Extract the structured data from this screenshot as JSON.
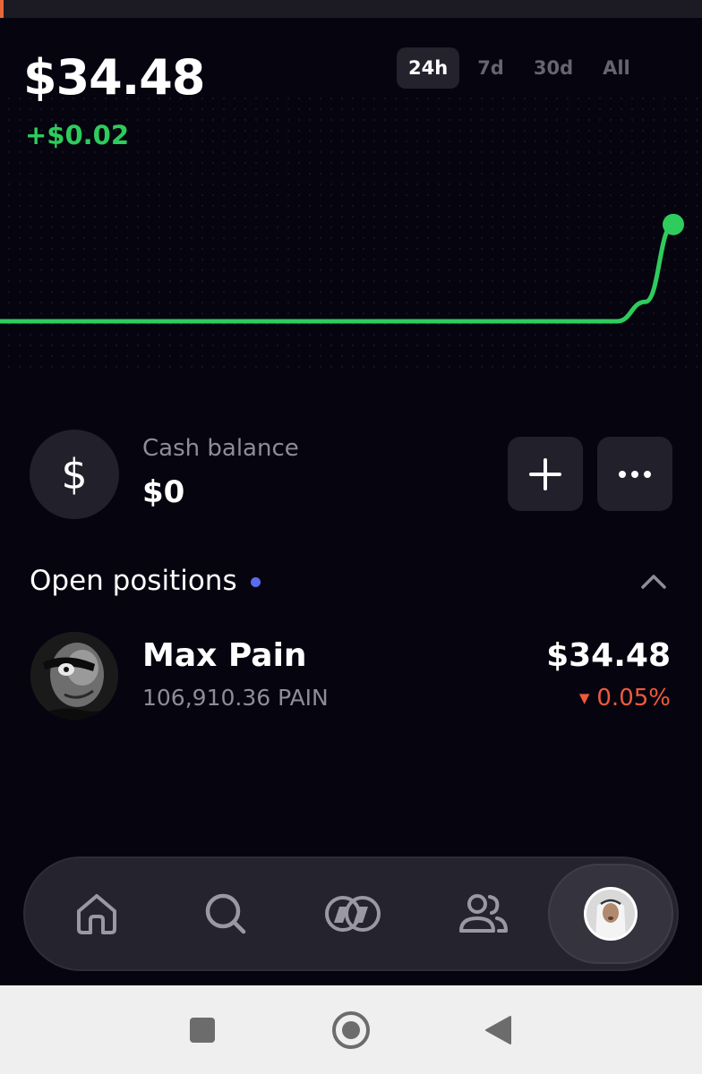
{
  "portfolio": {
    "balance_main": "$34",
    "balance_cents": ".48",
    "change": "+$0.02"
  },
  "range_tabs": [
    {
      "label": "24h",
      "active": true
    },
    {
      "label": "7d",
      "active": false
    },
    {
      "label": "30d",
      "active": false
    },
    {
      "label": "All",
      "active": false
    }
  ],
  "chart_data": {
    "type": "line",
    "title": "",
    "xlabel": "",
    "ylabel": "",
    "grid": false,
    "series": [
      {
        "values": [
          34.46,
          34.46,
          34.46,
          34.46,
          34.46,
          34.46,
          34.46,
          34.46,
          34.46,
          34.46,
          34.46,
          34.46,
          34.46,
          34.46,
          34.46,
          34.46,
          34.46,
          34.46,
          34.46,
          34.46,
          34.46,
          34.46,
          34.46,
          34.464,
          34.48
        ]
      }
    ],
    "ylim": [
      34.455,
      34.482
    ],
    "line_color": "#2ecc5c"
  },
  "cash": {
    "icon": "dollar-sign-icon",
    "symbol": "$",
    "label": "Cash balance",
    "value": "$0",
    "add_icon": "plus-icon",
    "more_icon": "more-horizontal-icon"
  },
  "open_positions": {
    "title": "Open positions",
    "indicator_color": "#5a6bf0",
    "collapse_icon": "chevron-up-icon",
    "items": [
      {
        "name": "Max Pain",
        "amount": "106,910.36 PAIN",
        "value": "$34.48",
        "change_arrow": "▼",
        "change": "0.05%",
        "change_color": "#ef5a3c"
      }
    ]
  },
  "nav": {
    "items": [
      {
        "icon": "home-icon"
      },
      {
        "icon": "search-icon"
      },
      {
        "icon": "trade-coins-icon"
      },
      {
        "icon": "users-icon"
      },
      {
        "icon": "profile-avatar-icon",
        "active": true
      }
    ]
  },
  "system_nav": {
    "recents_icon": "square-icon",
    "home_icon": "circle-home-icon",
    "back_icon": "triangle-back-icon"
  },
  "colors": {
    "background": "#06050f",
    "accent_green": "#2ecc5c",
    "negative_red": "#ef5a3c",
    "surface": "#22212b"
  }
}
